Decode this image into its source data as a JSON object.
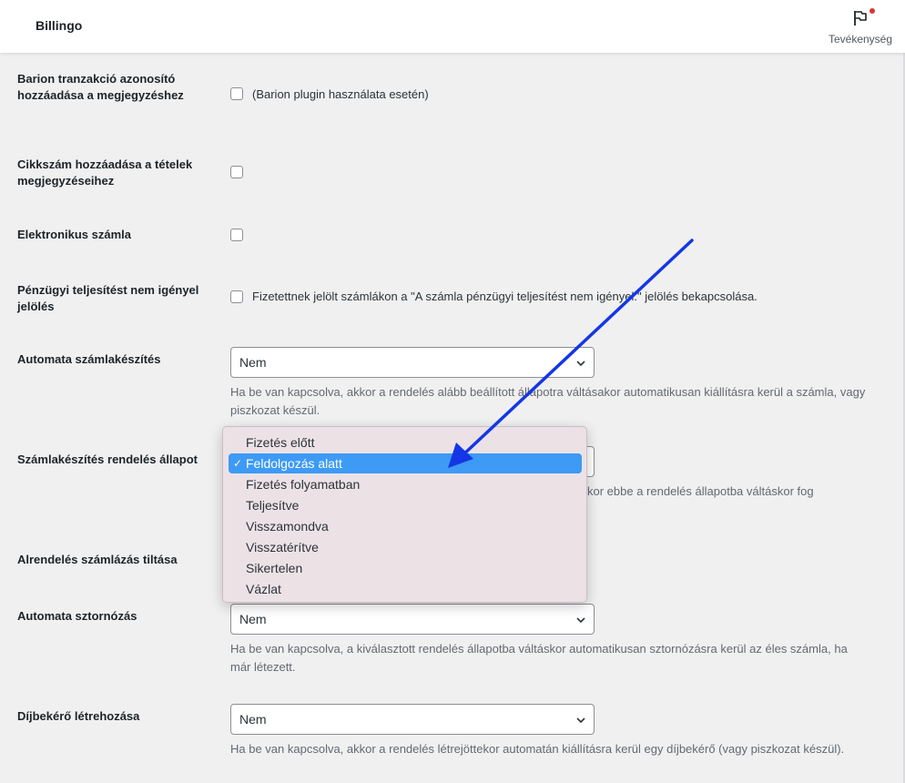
{
  "header": {
    "app_title": "Billingo",
    "activity_label": "Tevékenység"
  },
  "settings": [
    {
      "label": "Barion tranzakció azonosító hozzáadása a megjegyzéshez",
      "checkbox_text": "(Barion plugin használata esetén)",
      "checked": false
    },
    {
      "label": "Cikkszám hozzáadása a tételek megjegyzéseihez",
      "checkbox_text": "",
      "checked": false
    },
    {
      "label": "Elektronikus számla",
      "checkbox_text": "",
      "checked": false
    },
    {
      "label": "Pénzügyi teljesítést nem igényel jelölés",
      "checkbox_text": "Fizetettnek jelölt számlákon a \"A számla pénzügyi teljesítést nem igényel.\" jelölés bekapcsolása.",
      "checked": false
    },
    {
      "label": "Automata számlakészítés",
      "select_value": "Nem",
      "description": "Ha be van kapcsolva, akkor a rendelés alább beállított állapotra váltásakor automatikusan kiállításra kerül a számla, vagy piszkozat készül."
    },
    {
      "label": "Számlakészítés rendelés állapot",
      "description_fragment": "kor ebbe a rendelés állapotba váltáskor fog"
    },
    {
      "label": "Alrendelés számlázás tiltása"
    },
    {
      "label": "Automata sztornózás",
      "select_value": "Nem",
      "description": "Ha be van kapcsolva, a kiválasztott rendelés állapotba váltáskor automatikusan sztornózásra kerül az éles számla, ha már létezett."
    },
    {
      "label": "Díjbekérő létrehozása",
      "select_value": "Nem",
      "description": "Ha be van kapcsolva, akkor a rendelés létrejöttekor automatán kiállításra kerül egy díjbekérő (vagy piszkozat készül)."
    }
  ],
  "dropdown": {
    "selected_index": 1,
    "check_mark": "✓",
    "options": [
      "Fizetés előtt",
      "Feldolgozás alatt",
      "Fizetés folyamatban",
      "Teljesítve",
      "Visszamondva",
      "Visszatérítve",
      "Sikertelen",
      "Vázlat"
    ]
  },
  "colors": {
    "accent": "#3d9af5",
    "annotation_arrow": "#1436e6",
    "notification_dot": "#d63638"
  }
}
